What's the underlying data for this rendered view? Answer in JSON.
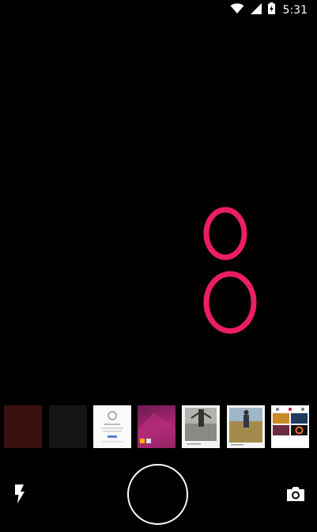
{
  "status_bar": {
    "time": "5:31",
    "icons": [
      "wifi-icon",
      "signal-icon",
      "battery-charging-icon"
    ]
  },
  "viewfinder": {
    "icons": [
      "focus-ring-icon"
    ],
    "ring_color": "#e91e63"
  },
  "gallery": {
    "items": [
      {
        "name": "dark-red-photo"
      },
      {
        "name": "dark-gray-photo"
      },
      {
        "name": "app-screenshot"
      },
      {
        "name": "magenta-wallpaper"
      },
      {
        "name": "person-floating-photo"
      },
      {
        "name": "person-in-field-photo"
      },
      {
        "name": "photo-grid-screenshot"
      }
    ]
  },
  "controls": {
    "flash_icon": "flash-icon",
    "shutter": "shutter-button",
    "switch_icon": "camera-icon"
  }
}
